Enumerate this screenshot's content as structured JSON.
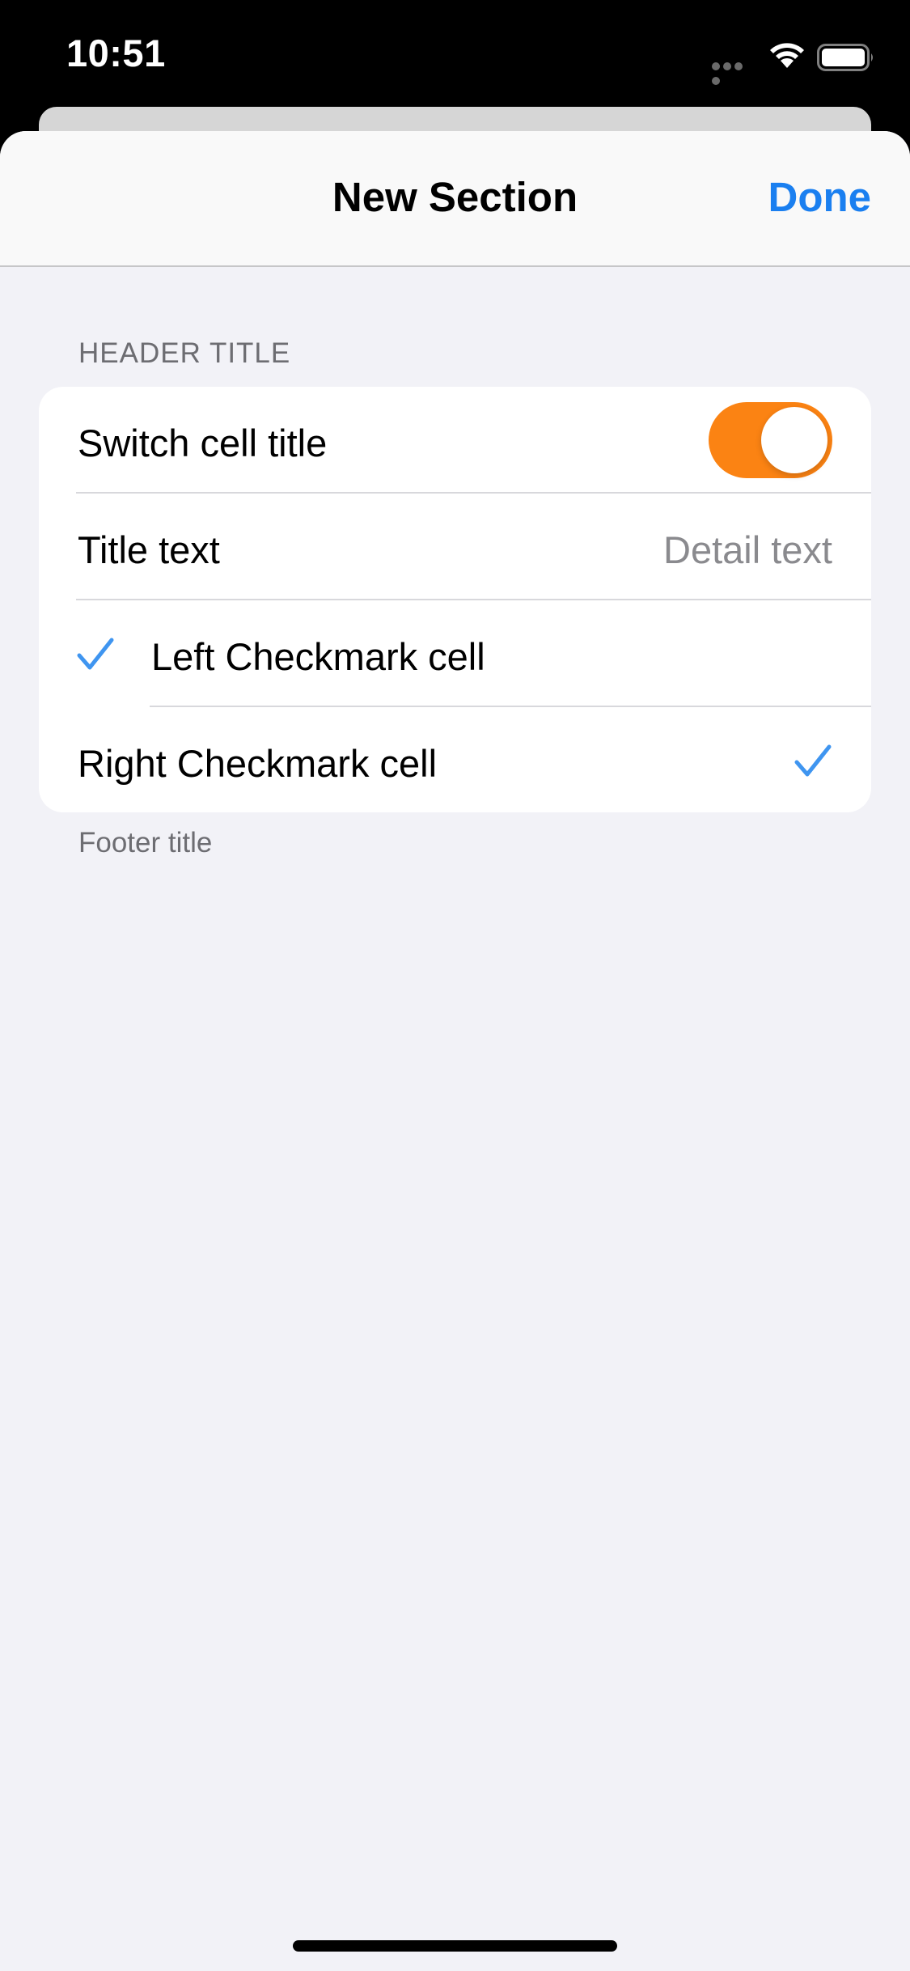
{
  "status_bar": {
    "time": "10:51",
    "wifi_icon": "wifi-icon",
    "battery_icon": "battery-icon",
    "signal_icon": "cellular-signal-icon"
  },
  "nav": {
    "title": "New Section",
    "done_label": "Done"
  },
  "section": {
    "header": "HEADER TITLE",
    "footer": "Footer title",
    "cells": {
      "switch": {
        "title": "Switch cell title",
        "on": true
      },
      "detail": {
        "title": "Title text",
        "detail": "Detail text"
      },
      "left_check": {
        "title": "Left Checkmark cell",
        "checked": true
      },
      "right_check": {
        "title": "Right Checkmark cell",
        "checked": true
      }
    }
  },
  "colors": {
    "accent": "#1a7ff0",
    "switch_on": "#fb8313",
    "checkmark": "#3f95f0",
    "background": "#f2f2f7"
  }
}
